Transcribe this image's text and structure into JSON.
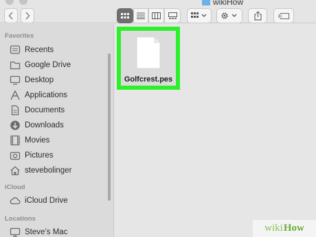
{
  "window": {
    "title": "wikiHow"
  },
  "toolbar": {
    "back_icon": "chevron-left-icon",
    "forward_icon": "chevron-right-icon",
    "view_modes": [
      "icon-view-icon",
      "list-view-icon",
      "column-view-icon",
      "gallery-view-icon"
    ],
    "active_view": "icon-view-icon",
    "group_icon": "group-by-icon",
    "action_icon": "gear-icon",
    "share_icon": "share-icon",
    "tags_icon": "tag-icon"
  },
  "sidebar": {
    "favorites_heading": "Favorites",
    "favorites": [
      {
        "label": "Recents",
        "icon": "clock-icon"
      },
      {
        "label": "Google Drive",
        "icon": "folder-icon"
      },
      {
        "label": "Desktop",
        "icon": "desktop-icon"
      },
      {
        "label": "Applications",
        "icon": "applications-icon"
      },
      {
        "label": "Documents",
        "icon": "document-icon"
      },
      {
        "label": "Downloads",
        "icon": "download-icon"
      },
      {
        "label": "Movies",
        "icon": "film-icon"
      },
      {
        "label": "Pictures",
        "icon": "camera-icon"
      },
      {
        "label": "stevebolinger",
        "icon": "home-icon"
      }
    ],
    "icloud_heading": "iCloud",
    "icloud": [
      {
        "label": "iCloud Drive",
        "icon": "cloud-icon"
      }
    ],
    "locations_heading": "Locations",
    "locations": [
      {
        "label": "Steve’s Mac",
        "icon": "computer-icon"
      }
    ]
  },
  "content": {
    "files": [
      {
        "name": "Golfcrest.pes",
        "icon": "document-icon",
        "highlight_color": "#2df02d"
      }
    ]
  },
  "watermark": {
    "part1": "wiki",
    "part2": "How"
  },
  "colors": {
    "highlight": "#2df02d",
    "folder": "#6ab1e8",
    "sidebar": "#dcdbdc"
  }
}
